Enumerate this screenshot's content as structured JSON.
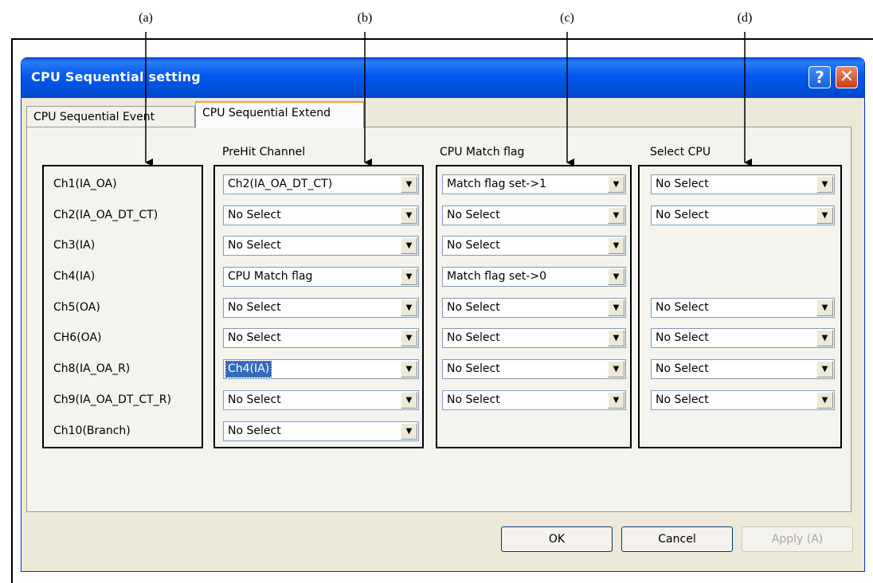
{
  "callouts": [
    "(a)",
    "(b)",
    "(c)",
    "(d)"
  ],
  "window": {
    "title": "CPU Sequential setting",
    "help_glyph": "?",
    "close_glyph": "✕"
  },
  "tabs": [
    {
      "label": "CPU Sequential Event"
    },
    {
      "label": "CPU Sequential Extend"
    }
  ],
  "groups": {
    "prehit_label": "PreHit Channel",
    "match_label": "CPU Match flag",
    "select_label": "Select CPU"
  },
  "channels": [
    "Ch1(IA_OA)",
    "Ch2(IA_OA_DT_CT)",
    "Ch3(IA)",
    "Ch4(IA)",
    "Ch5(OA)",
    "CH6(OA)",
    "Ch8(IA_OA_R)",
    "Ch9(IA_OA_DT_CT_R)",
    "Ch10(Branch)"
  ],
  "prehit": [
    "Ch2(IA_OA_DT_CT)",
    "No Select",
    "No Select",
    "CPU Match flag",
    "No Select",
    "No Select",
    "Ch4(IA)",
    "No Select",
    "No Select"
  ],
  "match": [
    "Match flag set->1",
    "No Select",
    "No Select",
    "Match flag set->0",
    "No Select",
    "No Select",
    "No Select",
    "No Select"
  ],
  "selectcpu": {
    "row1": "No Select",
    "row2": "No Select",
    "row5": "No Select",
    "row6": "No Select",
    "row7": "No Select",
    "row8": "No Select"
  },
  "dropdown_glyph": "▼",
  "buttons": {
    "ok": "OK",
    "cancel": "Cancel",
    "apply": "Apply (A)"
  }
}
